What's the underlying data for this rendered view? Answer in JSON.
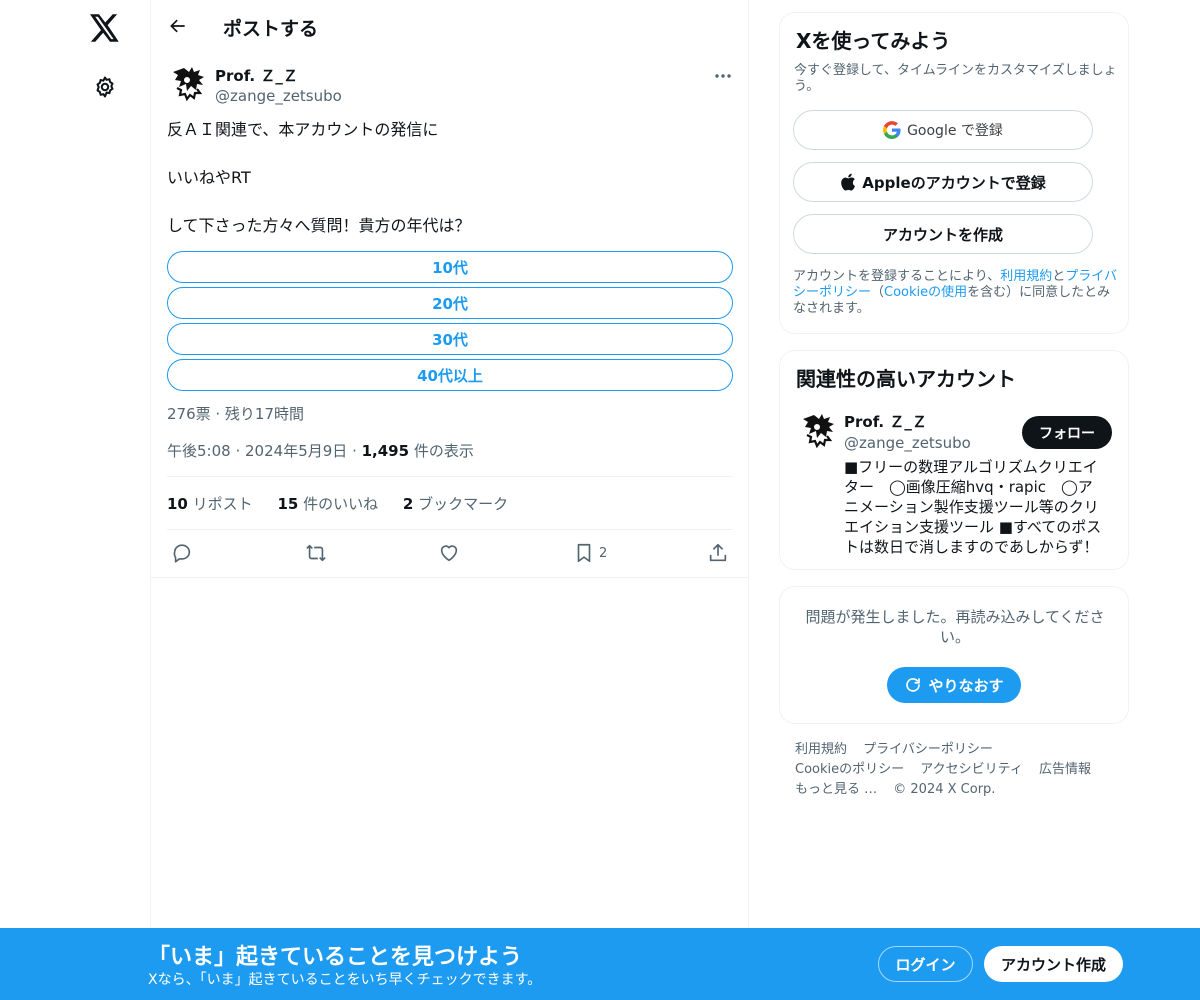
{
  "nav": {
    "logo_icon": "x-logo-icon",
    "settings_icon": "gear-icon"
  },
  "header": {
    "title": "ポストする"
  },
  "post": {
    "author_name": "Prof. Ｚ_Ｚ",
    "author_handle": "@zange_zetsubo",
    "text_lines": [
      "反ＡＩ関連で、本アカウントの発信に",
      "いいねやRT",
      "して下さった方々へ質問！貴方の年代は？"
    ],
    "poll_options": [
      "10代",
      "20代",
      "30代",
      "40代以上"
    ],
    "poll_meta": "276票 · 残り17時間",
    "time": "午後5:08",
    "date": "2024年5月9日",
    "view_count": "1,495",
    "view_label": "件の表示",
    "reposts_count": "10",
    "reposts_label": "リポスト",
    "likes_count": "15",
    "likes_label": "件のいいね",
    "bookmarks_count": "2",
    "bookmarks_label": "ブックマーク",
    "bookmark_action_count": "2"
  },
  "signup_card": {
    "title": "Xを使ってみよう",
    "subtitle": "今すぐ登録して、タイムラインをカスタマイズしましょう。",
    "google_label": "Google で登録",
    "apple_label": "Appleのアカウントで登録",
    "create_label": "アカウントを作成",
    "terms_pre": "アカウントを登録することにより、",
    "terms_link1": "利用規約",
    "terms_mid": "と",
    "terms_link2": "プライバシーポリシー",
    "terms_paren_open": "（",
    "terms_link3": "Cookieの使用",
    "terms_post": "を含む）に同意したとみなされます。"
  },
  "related_card": {
    "title": "関連性の高いアカウント",
    "name": "Prof. Ｚ_Ｚ",
    "handle": "@zange_zetsubo",
    "follow_label": "フォロー",
    "bio": "■フリーの数理アルゴリズムクリエイター　◯画像圧縮hvq・rapic　◯アニメーション製作支援ツール等のクリエイション支援ツール ■すべてのポストは数日で消しますのであしからず！"
  },
  "error_card": {
    "message": "問題が発生しました。再読み込みしてください。",
    "retry_label": "やりなおす"
  },
  "footer": {
    "links": [
      "利用規約",
      "プライバシーポリシー",
      "Cookieのポリシー",
      "アクセシビリティ",
      "広告情報",
      "もっと見る …",
      "© 2024 X Corp."
    ]
  },
  "banner": {
    "title": "「いま」起きていることを見つけよう",
    "subtitle": "Xなら、「いま」起きていることをいち早くチェックできます。",
    "login_label": "ログイン",
    "signup_label": "アカウント作成"
  },
  "colors": {
    "accent": "#1d9bf0",
    "text": "#0f1419",
    "muted": "#536471",
    "border": "#eff3f4"
  }
}
